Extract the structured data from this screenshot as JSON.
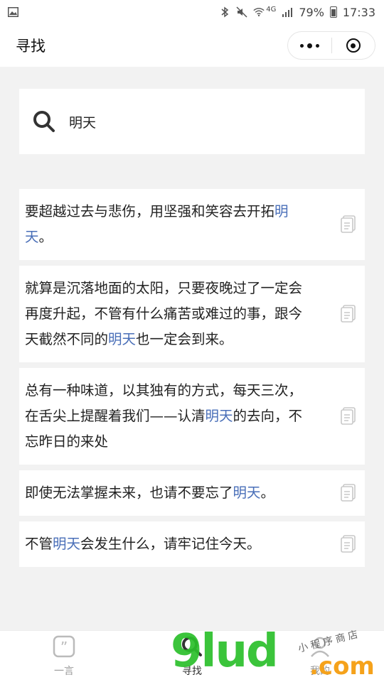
{
  "status_bar": {
    "battery": "79%",
    "time": "17:33",
    "network": "4G",
    "icons": [
      "image-icon",
      "bluetooth-icon",
      "mute-icon",
      "wifi-icon",
      "signal-icon",
      "battery-icon"
    ]
  },
  "nav": {
    "title": "寻找",
    "capsule": [
      "more-dots-icon",
      "close-target-icon"
    ]
  },
  "search": {
    "icon": "search-icon",
    "query": "明天"
  },
  "results": [
    {
      "before": "要超越过去与悲伤，用坚强和笑容去开拓",
      "highlight": "明天",
      "after": "。"
    },
    {
      "before": "就算是沉落地面的太阳，只要夜晚过了一定会再度升起，不管有什么痛苦或难过的事，跟今天截然不同的",
      "highlight": "明天",
      "after": "也一定会到来。"
    },
    {
      "before": "总有一种味道，以其独有的方式，每天三次，在舌尖上提醒着我们——认清",
      "highlight": "明天",
      "after": "的去向，不忘昨日的来处"
    },
    {
      "before": "即使无法掌握未来，也请不要忘了",
      "highlight": "明天",
      "after": "。"
    },
    {
      "before": "不管",
      "highlight": "明天",
      "after": "会发生什么，请牢记住今天。"
    }
  ],
  "tabs": [
    {
      "label": "一言",
      "icon": "quote-icon",
      "active": false
    },
    {
      "label": "寻找",
      "icon": "search-icon",
      "active": true
    },
    {
      "label": "我的",
      "icon": "user-icon",
      "active": false
    }
  ],
  "watermark": {
    "main": "9lud",
    "com": ".com",
    "sub": "小程序商店"
  },
  "colors": {
    "highlight": "#4a6fb8",
    "watermark_green": "#2bbf2b",
    "watermark_orange": "#f5a21b",
    "background": "#f2f2f2"
  }
}
